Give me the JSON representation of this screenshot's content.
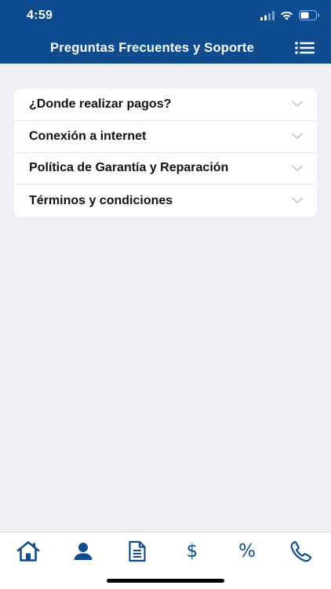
{
  "status_bar": {
    "time": "4:59"
  },
  "header": {
    "title": "Preguntas Frecuentes y Soporte",
    "menu_icon": "list-menu-icon"
  },
  "faq": {
    "items": [
      {
        "label": "¿Donde realizar pagos?"
      },
      {
        "label": "Conexión a internet"
      },
      {
        "label": "Política de Garantía y Reparación"
      },
      {
        "label": "Términos y condiciones"
      }
    ]
  },
  "tab_bar": {
    "tabs": [
      {
        "icon": "home-icon"
      },
      {
        "icon": "person-icon"
      },
      {
        "icon": "document-icon"
      },
      {
        "icon": "dollar-icon",
        "glyph": "$"
      },
      {
        "icon": "percent-icon",
        "glyph": "%"
      },
      {
        "icon": "phone-icon"
      }
    ]
  },
  "colors": {
    "brand": "#0f4c8f",
    "background": "#efeff4",
    "card": "#ffffff",
    "chevron": "#c7c7cc"
  }
}
